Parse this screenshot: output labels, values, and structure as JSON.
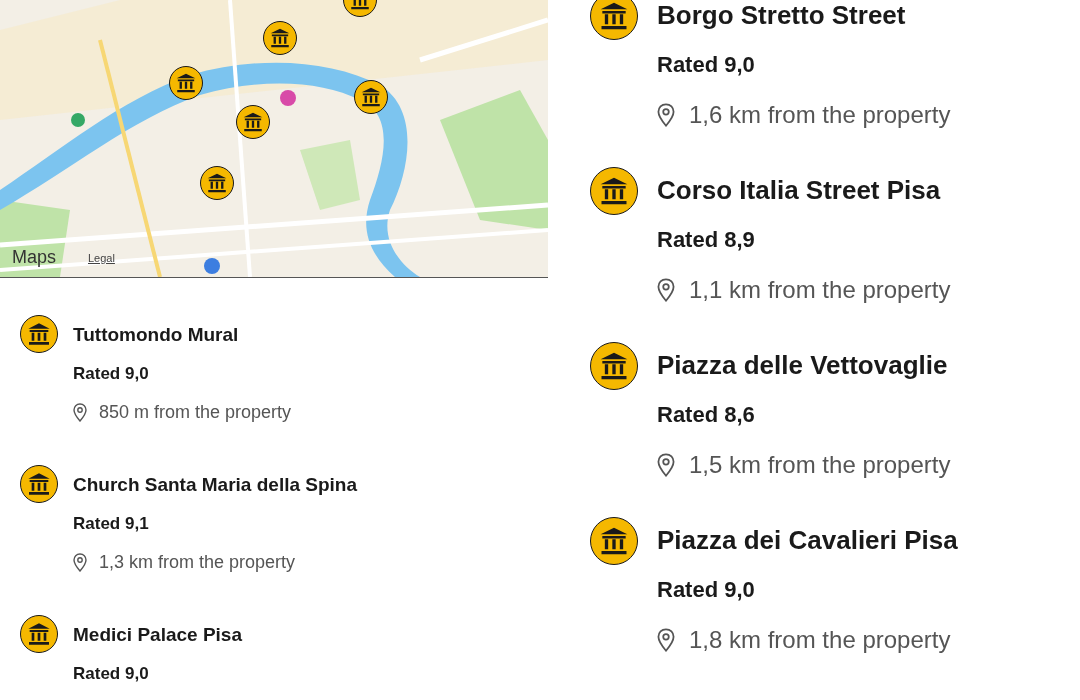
{
  "map": {
    "kind": "picture",
    "brand": "Maps",
    "legal": "Legal"
  },
  "left_list": [
    {
      "name": "Tuttomondo Mural",
      "rating": "Rated 9,0",
      "distance": "850 m from the property"
    },
    {
      "name": "Church Santa Maria della Spina",
      "rating": "Rated 9,1",
      "distance": "1,3 km from the property"
    },
    {
      "name": "Medici Palace Pisa",
      "rating": "Rated 9,0"
    }
  ],
  "right_list": [
    {
      "name": "Borgo Stretto Street",
      "rating": "Rated 9,0",
      "distance": "1,6 km from the property"
    },
    {
      "name": "Corso Italia Street Pisa",
      "rating": "Rated 8,9",
      "distance": "1,1 km from the property"
    },
    {
      "name": "Piazza delle Vettovaglie",
      "rating": "Rated 8,6",
      "distance": "1,5 km from the property"
    },
    {
      "name": "Piazza dei Cavalieri Pisa",
      "rating": "Rated 9,0",
      "distance": "1,8 km from the property"
    }
  ]
}
